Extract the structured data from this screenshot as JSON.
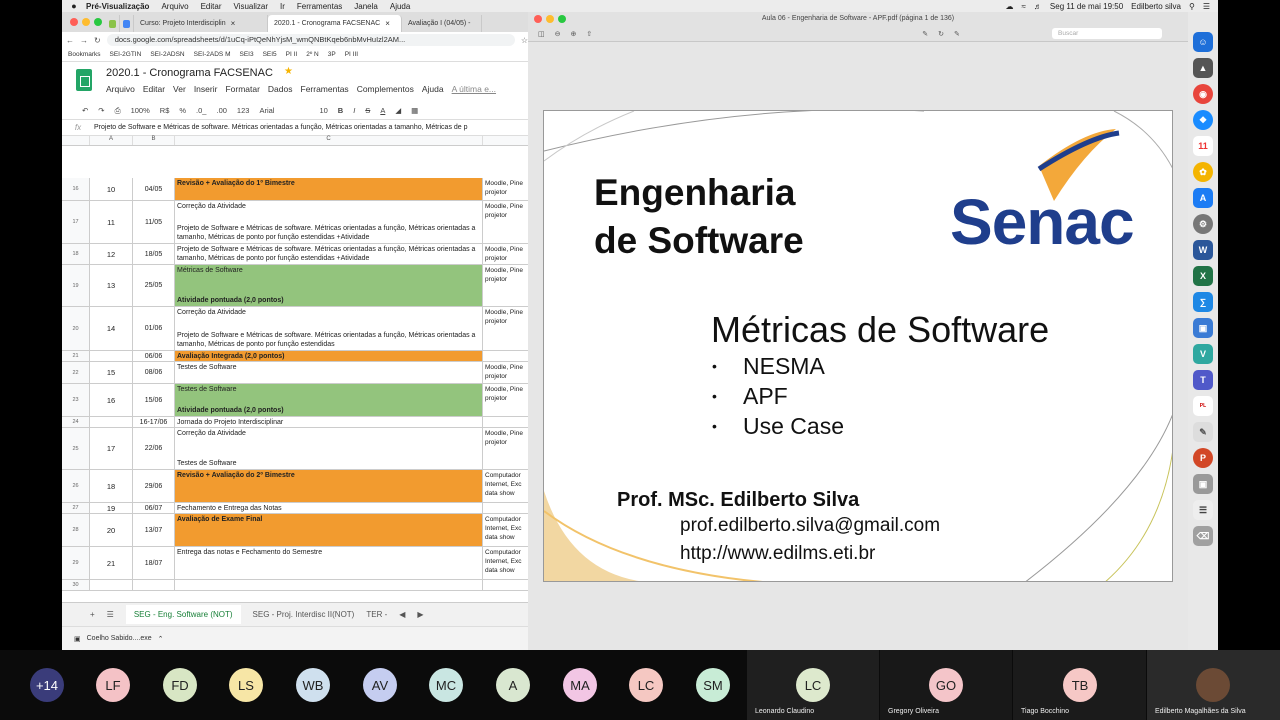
{
  "menubar": {
    "app": "Pré-Visualização",
    "items": [
      "Arquivo",
      "Editar",
      "Visualizar",
      "Ir",
      "Ferramentas",
      "Janela",
      "Ajuda"
    ],
    "clock": "Seg 11 de mai  19:50",
    "user": "Edilberto silva"
  },
  "browser": {
    "tabs": [
      {
        "label": "Curso: Projeto Interdisciplin"
      },
      {
        "label": "2020.1 - Cronograma FACSENAC"
      },
      {
        "label": "Avaliação I (04/05) -"
      }
    ],
    "url": "docs.google.com/spreadsheets/d/1uCq-iPtQeNhYjsM_wmQNBtKqeb6nbMvHuIzl2AM...",
    "bookmarks": [
      "Bookmarks",
      "SEI-2GTIN",
      "SEI-2ADSN",
      "SEI-2ADS M",
      "SEI3",
      "SEI5",
      "PI II",
      "2º N",
      "3P",
      "PI III"
    ],
    "download": "Coelho Sabido....exe"
  },
  "sheet": {
    "title": "2020.1 - Cronograma FACSENAC",
    "menu": [
      "Arquivo",
      "Editar",
      "Ver",
      "Inserir",
      "Formatar",
      "Dados",
      "Ferramentas",
      "Complementos",
      "Ajuda"
    ],
    "last_edit": "A última e...",
    "toolbar": {
      "zoom": "100%",
      "currency": "R$",
      "percent": "%",
      "dec0": ".0_",
      "dec00": ".00",
      "fmt": "123",
      "font": "Arial",
      "size": "10",
      "bold": "B",
      "italic": "I",
      "strike": "S",
      "color": "A"
    },
    "formula": "Projeto de Software e Métricas de software. Métricas orientadas a função, Métricas orientadas a tamanho, Métricas de p",
    "columns": [
      "A",
      "B",
      "C"
    ],
    "rows": [
      {
        "n": "16",
        "a": "10",
        "b": "04/05",
        "c1": "Revisão + Avaliação do 1º Bimestre",
        "c2": "",
        "d": "Moodle, Pine projetor",
        "style": "orange"
      },
      {
        "n": "17",
        "a": "11",
        "b": "11/05",
        "c1": "Correção da Atividade",
        "c2": "Projeto de Software e Métricas de software. Métricas orientadas a função, Métricas orientadas a tamanho, Métricas de ponto por função estendidas +Atividade",
        "d": "Moodle, Pine projetor",
        "style": "plain"
      },
      {
        "n": "18",
        "a": "12",
        "b": "18/05",
        "c1": "Projeto de Software e Métricas de software. Métricas orientadas a função, Métricas orientadas a tamanho, Métricas de ponto por função estendidas +Atividade",
        "c2": "",
        "d": "Moodle, Pine projetor",
        "style": "plain"
      },
      {
        "n": "19",
        "a": "13",
        "b": "25/05",
        "c1": "Métricas de Software",
        "c2": "Atividade pontuada (2,0 pontos)",
        "d": "Moodle, Pine projetor",
        "style": "green"
      },
      {
        "n": "20",
        "a": "14",
        "b": "01/06",
        "c1": "Correção da Atividade",
        "c2": "Projeto de Software e Métricas de software. Métricas orientadas a função, Métricas orientadas a tamanho, Métricas de ponto por função estendidas",
        "d": "Moodle, Pine projetor",
        "style": "plain"
      },
      {
        "n": "21",
        "a": "",
        "b": "06/06",
        "c1": "Avaliação Integrada (2,0 pontos)",
        "c2": "",
        "d": "",
        "style": "orange"
      },
      {
        "n": "22",
        "a": "15",
        "b": "08/06",
        "c1": "Testes de Software",
        "c2": "",
        "d": "Moodle, Pine projetor",
        "style": "plain"
      },
      {
        "n": "23",
        "a": "16",
        "b": "15/06",
        "c1": "Testes de Software",
        "c2": "Atividade pontuada (2,0 pontos)",
        "d": "Moodle, Pine projetor",
        "style": "green"
      },
      {
        "n": "24",
        "a": "",
        "b": "16-17/06",
        "c1": "Jornada do Projeto Interdisciplinar",
        "c2": "",
        "d": "",
        "style": "plain"
      },
      {
        "n": "25",
        "a": "17",
        "b": "22/06",
        "c1": "Correção da Atividade",
        "c2": "Testes de Software",
        "d": "Moodle, Pine projetor",
        "style": "plain"
      },
      {
        "n": "26",
        "a": "18",
        "b": "29/06",
        "c1": "Revisão + Avaliação do 2º Bimestre",
        "c2": "",
        "d": "Computador Internet, Exc data show",
        "style": "orange"
      },
      {
        "n": "27",
        "a": "19",
        "b": "06/07",
        "c1": "Fechamento e Entrega das Notas",
        "c2": "",
        "d": "",
        "style": "plain"
      },
      {
        "n": "28",
        "a": "20",
        "b": "13/07",
        "c1": "Avaliação de Exame Final",
        "c2": "",
        "d": "Computador Internet, Exc data show",
        "style": "orange"
      },
      {
        "n": "29",
        "a": "21",
        "b": "18/07",
        "c1": "Entrega das notas e Fechamento do Semestre",
        "c2": "",
        "d": "Computador Internet, Exc data show",
        "style": "plain"
      },
      {
        "n": "30",
        "a": "",
        "b": "",
        "c1": "",
        "c2": "",
        "d": "",
        "style": "plain"
      }
    ],
    "sheet_tabs": [
      "SEG - Eng. Software (NOT)",
      "SEG - Proj. Interdisc II(NOT)",
      "TER -"
    ]
  },
  "preview": {
    "window_title": "Aula 06 - Engenharia de Software - APF.pdf (página 1 de 136)",
    "search_placeholder": "Buscar",
    "slide": {
      "title_line1": "Engenharia",
      "title_line2": "de Software",
      "logo": "Senac",
      "heading": "Métricas de Software",
      "bullets": [
        "NESMA",
        "APF",
        "Use Case"
      ],
      "author": "Prof. MSc. Edilberto Silva",
      "email": "prof.edilberto.silva@gmail.com",
      "site": "http://www.edilms.eti.br"
    }
  },
  "participants": {
    "more": "+14",
    "avatars": [
      {
        "initials": "LF",
        "color": "#f4c2c6"
      },
      {
        "initials": "FD",
        "color": "#d8e6c4"
      },
      {
        "initials": "LS",
        "color": "#f7e6a6"
      },
      {
        "initials": "WB",
        "color": "#cfe0ee"
      },
      {
        "initials": "AV",
        "color": "#c5cdf0"
      },
      {
        "initials": "MC",
        "color": "#c9e6e2"
      },
      {
        "initials": "A",
        "color": "#d9e7d0"
      },
      {
        "initials": "MA",
        "color": "#f2c6e4"
      },
      {
        "initials": "LC",
        "color": "#f5c8c2"
      },
      {
        "initials": "SM",
        "color": "#c8ecd6"
      }
    ],
    "tiles": [
      {
        "initials": "LC",
        "name": "Leonardo Claudino",
        "color": "#dde9cd"
      },
      {
        "initials": "GO",
        "name": "Gregory Oliveira",
        "color": "#f4c5c9"
      },
      {
        "initials": "TB",
        "name": "Tiago Bocchino",
        "color": "#f6c8c6"
      },
      {
        "initials": "",
        "name": "Edilberto Magalhães da Silva",
        "color": "#6b4a35"
      }
    ]
  }
}
